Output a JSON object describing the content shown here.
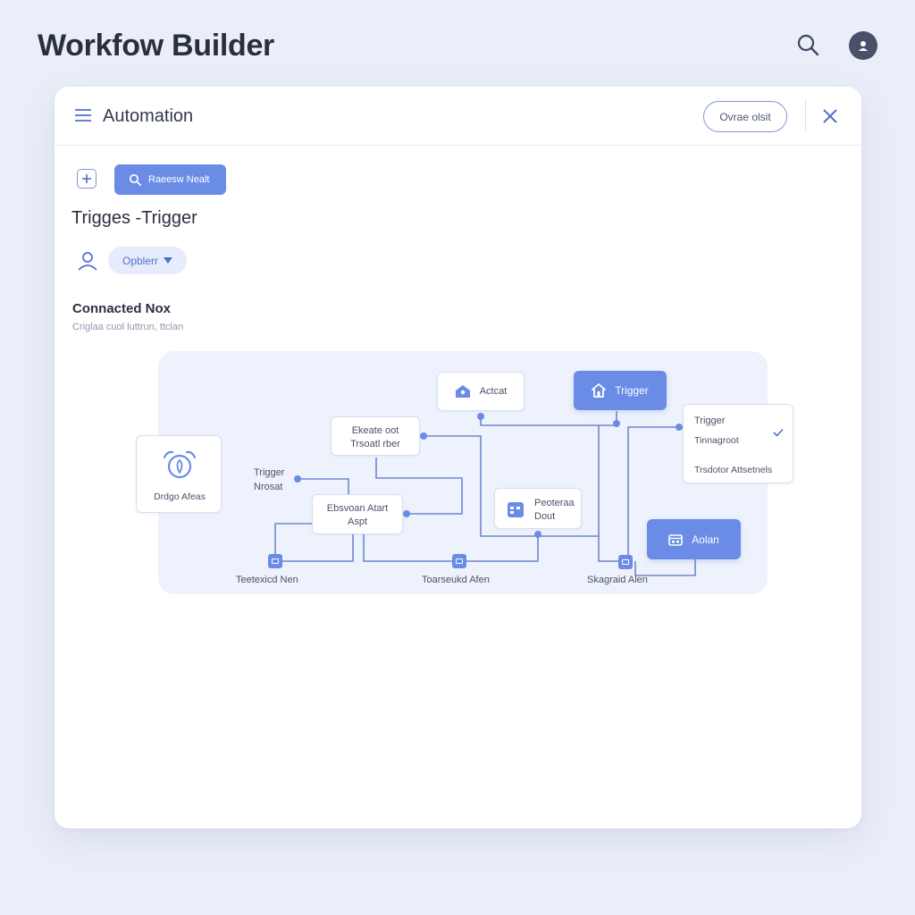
{
  "app": {
    "title": "Workfow Builder"
  },
  "panel": {
    "title": "Automation",
    "header_pill": "Ovrae olsit",
    "toolbar": {
      "search_label": "Raeesw Nealt"
    },
    "section_title": "Trigges -Trigger",
    "dropdown": {
      "value": "Opblerr"
    },
    "sub_title": "Connacted Nox",
    "sub_desc": "Criglaa cuol luttrun, ttclan"
  },
  "nodes": {
    "alarm": "Drdgo Afeas",
    "actcat": "Actcat",
    "trigger_top": "Trigger",
    "create": [
      "Ekeate oot",
      "Trsoatl rber"
    ],
    "trig_label": [
      "Trigger",
      "Nrosat"
    ],
    "evento": [
      "Ebsvoan Atart",
      "Aspt"
    ],
    "peoteraa": [
      "Peoteraa",
      "Dout"
    ],
    "popup": {
      "line1": "Trigger",
      "line2": "Tinnagroot",
      "line3": "Trsdotor Attsetnels"
    },
    "action": "Aolan"
  },
  "bottom_labels": [
    "Teetexicd Nen",
    "Toarseukd Afen",
    "Skagraid Alen"
  ],
  "colors": {
    "accent": "#6a8ce6",
    "background": "#eaeef8",
    "canvas": "#eef2fc",
    "wire": "#6f86cf"
  },
  "icons": [
    "search-icon",
    "user-avatar-icon",
    "menu-icon",
    "close-icon",
    "add-icon",
    "person-icon",
    "alarm-icon",
    "home-icon",
    "calendar-icon",
    "check-icon"
  ]
}
